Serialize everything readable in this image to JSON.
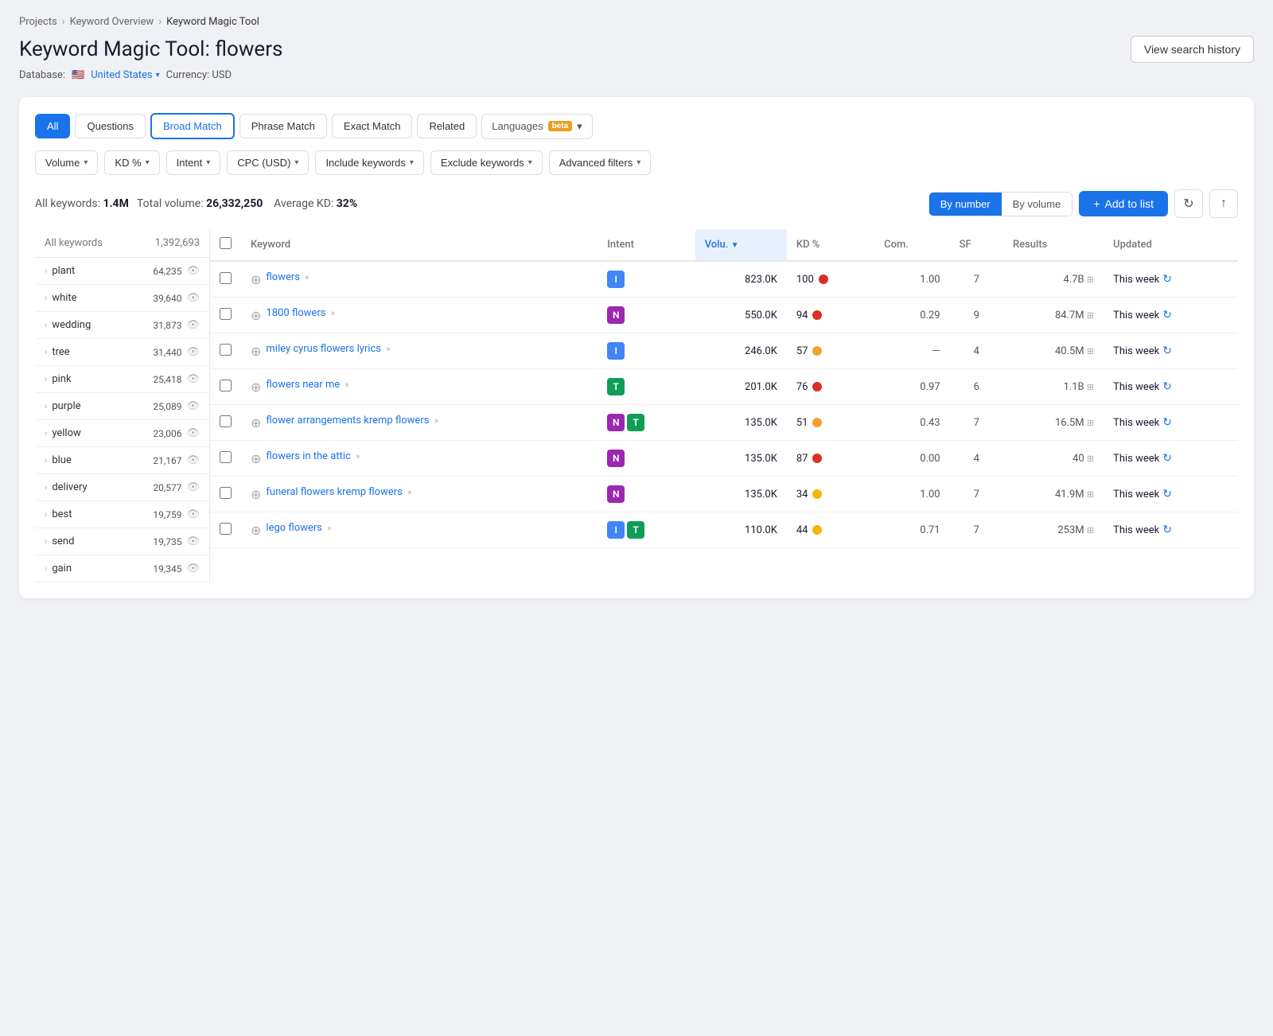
{
  "breadcrumb": {
    "items": [
      "Projects",
      "Keyword Overview",
      "Keyword Magic Tool"
    ]
  },
  "header": {
    "title_static": "Keyword Magic Tool:",
    "title_keyword": "flowers",
    "view_history_label": "View search history",
    "database_label": "Database:",
    "database_value": "United States",
    "currency_label": "Currency: USD"
  },
  "tabs": [
    {
      "id": "all",
      "label": "All",
      "active": true
    },
    {
      "id": "questions",
      "label": "Questions",
      "active": false
    },
    {
      "id": "broad-match",
      "label": "Broad Match",
      "active": true,
      "outlined": true
    },
    {
      "id": "phrase-match",
      "label": "Phrase Match",
      "active": false
    },
    {
      "id": "exact-match",
      "label": "Exact Match",
      "active": false
    },
    {
      "id": "related",
      "label": "Related",
      "active": false
    }
  ],
  "languages_btn": "Languages",
  "beta_label": "beta",
  "filters": [
    {
      "id": "volume",
      "label": "Volume"
    },
    {
      "id": "kd",
      "label": "KD %"
    },
    {
      "id": "intent",
      "label": "Intent"
    },
    {
      "id": "cpc",
      "label": "CPC (USD)"
    },
    {
      "id": "include",
      "label": "Include keywords"
    },
    {
      "id": "exclude",
      "label": "Exclude keywords"
    },
    {
      "id": "advanced",
      "label": "Advanced filters"
    }
  ],
  "results_summary": {
    "prefix": "All keywords:",
    "keywords_count": "1.4M",
    "volume_prefix": "Total volume:",
    "total_volume": "26,332,250",
    "kd_prefix": "Average KD:",
    "average_kd": "32%"
  },
  "sort_buttons": [
    {
      "id": "by-number",
      "label": "By number",
      "active": true
    },
    {
      "id": "by-volume",
      "label": "By volume",
      "active": false
    }
  ],
  "add_to_list_label": "+ Add to list",
  "table_columns": [
    {
      "id": "keyword",
      "label": "Keyword"
    },
    {
      "id": "intent",
      "label": "Intent"
    },
    {
      "id": "volume",
      "label": "Volu.",
      "sorted": true
    },
    {
      "id": "kd",
      "label": "KD %"
    },
    {
      "id": "com",
      "label": "Com."
    },
    {
      "id": "sf",
      "label": "SF"
    },
    {
      "id": "results",
      "label": "Results"
    },
    {
      "id": "updated",
      "label": "Updated"
    }
  ],
  "sidebar_keywords": [
    {
      "name": "All keywords",
      "count": "1,392,693",
      "has_expand": false
    },
    {
      "name": "plant",
      "count": "64,235",
      "has_expand": true
    },
    {
      "name": "white",
      "count": "39,640",
      "has_expand": true
    },
    {
      "name": "wedding",
      "count": "31,873",
      "has_expand": true
    },
    {
      "name": "tree",
      "count": "31,440",
      "has_expand": true
    },
    {
      "name": "pink",
      "count": "25,418",
      "has_expand": true
    },
    {
      "name": "purple",
      "count": "25,089",
      "has_expand": true
    },
    {
      "name": "yellow",
      "count": "23,006",
      "has_expand": true
    },
    {
      "name": "blue",
      "count": "21,167",
      "has_expand": true
    },
    {
      "name": "delivery",
      "count": "20,577",
      "has_expand": true
    },
    {
      "name": "best",
      "count": "19,759",
      "has_expand": true
    },
    {
      "name": "send",
      "count": "19,735",
      "has_expand": true
    },
    {
      "name": "gain",
      "count": "19,345",
      "has_expand": true
    }
  ],
  "table_rows": [
    {
      "keyword": "flowers",
      "keyword_arrows": ">>",
      "intents": [
        {
          "type": "I",
          "class": "intent-i"
        }
      ],
      "volume": "823.0K",
      "kd": "100",
      "kd_dot": "dot-red",
      "com": "1.00",
      "sf": "7",
      "results": "4.7B",
      "updated": "This week"
    },
    {
      "keyword": "1800 flowers",
      "keyword_arrows": ">>",
      "intents": [
        {
          "type": "N",
          "class": "intent-n"
        }
      ],
      "volume": "550.0K",
      "kd": "94",
      "kd_dot": "dot-red",
      "com": "0.29",
      "sf": "9",
      "results": "84.7M",
      "updated": "This week"
    },
    {
      "keyword": "miley cyrus flowers lyrics",
      "keyword_arrows": ">>",
      "intents": [
        {
          "type": "I",
          "class": "intent-i"
        }
      ],
      "volume": "246.0K",
      "kd": "57",
      "kd_dot": "dot-orange",
      "com": "—",
      "sf": "4",
      "results": "40.5M",
      "updated": "This week"
    },
    {
      "keyword": "flowers near me",
      "keyword_arrows": ">>",
      "intents": [
        {
          "type": "T",
          "class": "intent-t"
        }
      ],
      "volume": "201.0K",
      "kd": "76",
      "kd_dot": "dot-red",
      "com": "0.97",
      "sf": "6",
      "results": "1.1B",
      "updated": "This week"
    },
    {
      "keyword": "flower arrangements kremp flowers",
      "keyword_arrows": ">>",
      "intents": [
        {
          "type": "N",
          "class": "intent-n"
        },
        {
          "type": "T",
          "class": "intent-t"
        }
      ],
      "volume": "135.0K",
      "kd": "51",
      "kd_dot": "dot-orange",
      "com": "0.43",
      "sf": "7",
      "results": "16.5M",
      "updated": "This week"
    },
    {
      "keyword": "flowers in the attic",
      "keyword_arrows": ">>",
      "intents": [
        {
          "type": "N",
          "class": "intent-n"
        }
      ],
      "volume": "135.0K",
      "kd": "87",
      "kd_dot": "dot-red",
      "com": "0.00",
      "sf": "4",
      "results": "40",
      "updated": "This week"
    },
    {
      "keyword": "funeral flowers kremp flowers",
      "keyword_arrows": ">>",
      "intents": [
        {
          "type": "N",
          "class": "intent-n"
        }
      ],
      "volume": "135.0K",
      "kd": "34",
      "kd_dot": "dot-yellow",
      "com": "1.00",
      "sf": "7",
      "results": "41.9M",
      "updated": "This week"
    },
    {
      "keyword": "lego flowers",
      "keyword_arrows": ">>",
      "intents": [
        {
          "type": "I",
          "class": "intent-i"
        },
        {
          "type": "T",
          "class": "intent-t"
        }
      ],
      "volume": "110.0K",
      "kd": "44",
      "kd_dot": "dot-yellow",
      "com": "0.71",
      "sf": "7",
      "results": "253M",
      "updated": "This week"
    }
  ]
}
